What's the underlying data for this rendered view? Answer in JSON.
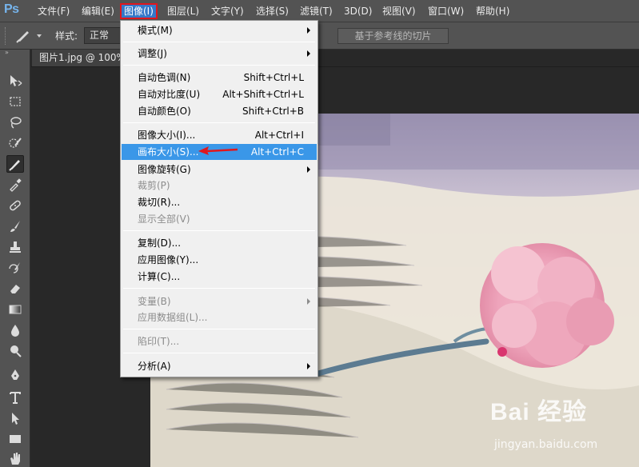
{
  "app": {
    "logo": "Ps"
  },
  "menubar": {
    "items": [
      {
        "label": "文件(F)"
      },
      {
        "label": "编辑(E)"
      },
      {
        "label": "图像(I)"
      },
      {
        "label": "图层(L)"
      },
      {
        "label": "文字(Y)"
      },
      {
        "label": "选择(S)"
      },
      {
        "label": "滤镜(T)"
      },
      {
        "label": "3D(D)"
      },
      {
        "label": "视图(V)"
      },
      {
        "label": "窗口(W)"
      },
      {
        "label": "帮助(H)"
      }
    ],
    "active_item": "图像(I)",
    "highlight_color": "#e0171d"
  },
  "options_bar": {
    "style_label": "样式:",
    "style_value": "正常",
    "slice_button": "基于参考线的切片"
  },
  "toolbox": {
    "tools": [
      "move-icon",
      "marquee-icon",
      "lasso-icon",
      "quick-select-icon",
      "slice-icon",
      "eyedropper-icon",
      "healing-brush-icon",
      "brush-icon",
      "clone-stamp-icon",
      "history-brush-icon",
      "eraser-icon",
      "gradient-icon",
      "blur-icon",
      "dodge-icon",
      "pen-icon",
      "type-icon",
      "path-select-icon",
      "rectangle-icon",
      "hand-icon"
    ],
    "selected_tool": "slice-icon"
  },
  "document": {
    "tab_title": "图片1.jpg @ 100%"
  },
  "image_menu": {
    "items": [
      {
        "label": "模式(M)",
        "shortcut": "",
        "submenu": true,
        "disabled": false
      },
      {
        "label": "调整(J)",
        "shortcut": "",
        "submenu": true,
        "disabled": false
      },
      {
        "label": "自动色调(N)",
        "shortcut": "Shift+Ctrl+L",
        "submenu": false,
        "disabled": false
      },
      {
        "label": "自动对比度(U)",
        "shortcut": "Alt+Shift+Ctrl+L",
        "submenu": false,
        "disabled": false
      },
      {
        "label": "自动颜色(O)",
        "shortcut": "Shift+Ctrl+B",
        "submenu": false,
        "disabled": false
      },
      {
        "label": "图像大小(I)...",
        "shortcut": "Alt+Ctrl+I",
        "submenu": false,
        "disabled": false
      },
      {
        "label": "画布大小(S)...",
        "shortcut": "Alt+Ctrl+C",
        "submenu": false,
        "disabled": false,
        "highlighted": true
      },
      {
        "label": "图像旋转(G)",
        "shortcut": "",
        "submenu": true,
        "disabled": false
      },
      {
        "label": "裁剪(P)",
        "shortcut": "",
        "submenu": false,
        "disabled": true
      },
      {
        "label": "裁切(R)...",
        "shortcut": "",
        "submenu": false,
        "disabled": false
      },
      {
        "label": "显示全部(V)",
        "shortcut": "",
        "submenu": false,
        "disabled": true
      },
      {
        "label": "复制(D)...",
        "shortcut": "",
        "submenu": false,
        "disabled": false
      },
      {
        "label": "应用图像(Y)...",
        "shortcut": "",
        "submenu": false,
        "disabled": false
      },
      {
        "label": "计算(C)...",
        "shortcut": "",
        "submenu": false,
        "disabled": false
      },
      {
        "label": "变量(B)",
        "shortcut": "",
        "submenu": true,
        "disabled": true
      },
      {
        "label": "应用数据组(L)...",
        "shortcut": "",
        "submenu": false,
        "disabled": true
      },
      {
        "label": "陷印(T)...",
        "shortcut": "",
        "submenu": false,
        "disabled": true
      },
      {
        "label": "分析(A)",
        "shortcut": "",
        "submenu": true,
        "disabled": false
      }
    ],
    "highlight_color": "#3a97e8",
    "annotation_arrow_color": "#e0171d"
  },
  "watermark": {
    "brand": "Bai 经验",
    "url": "jingyan.baidu.com"
  }
}
